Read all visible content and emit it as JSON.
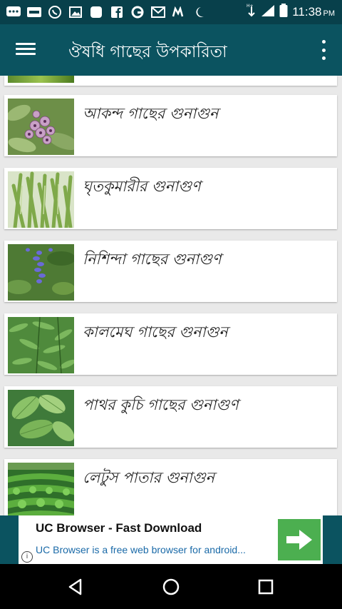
{
  "status_bar": {
    "time": "11:38",
    "ampm": "PM",
    "left_icons": [
      "messages-icon",
      "paytm-icon",
      "whatsapp-icon",
      "gallery-icon",
      "app-icon",
      "facebook-icon",
      "opera-icon",
      "gmail-icon",
      "mi-icon",
      "moon-icon"
    ],
    "right_icons": [
      "data-hplus-icon",
      "signal-icon",
      "battery-icon"
    ]
  },
  "app_bar": {
    "title": "ঔষধি গাছের উপকারিতা",
    "menu_icon": "hamburger-menu-icon",
    "overflow_icon": "more-vert-icon"
  },
  "items": [
    {
      "label": "আকন্দ গাছের গুনাগুন",
      "thumb": "calotropis-flowers"
    },
    {
      "label": "ঘৃতকুমারীর গুনাগুণ",
      "thumb": "aloe-vera"
    },
    {
      "label": "নিশিন্দা গাছের গুনাগুণ",
      "thumb": "nishinda-plant"
    },
    {
      "label": "কালমেঘ গাছের গুনাগুন",
      "thumb": "kalmegh-plant"
    },
    {
      "label": "পাথর কুচি গাছের গুনাগুণ",
      "thumb": "pathor-kuchi-leaves"
    },
    {
      "label": "লেটুস পাতার গুনাগুন",
      "thumb": "lettuce-field"
    }
  ],
  "ad": {
    "title": "UC Browser - Fast Download",
    "description": "UC Browser is a free web browser for android...",
    "info_glyph": "i",
    "cta_icon": "arrow-right-icon",
    "colors": {
      "cta": "#4caf50",
      "description": "#1a6aa8"
    }
  },
  "nav_bar": {
    "back_icon": "back-triangle-icon",
    "home_icon": "home-circle-icon",
    "recents_icon": "recents-square-icon"
  },
  "colors": {
    "status_bar": "#08404b",
    "app_bar": "#0b5360",
    "background": "#e9e9e9"
  }
}
